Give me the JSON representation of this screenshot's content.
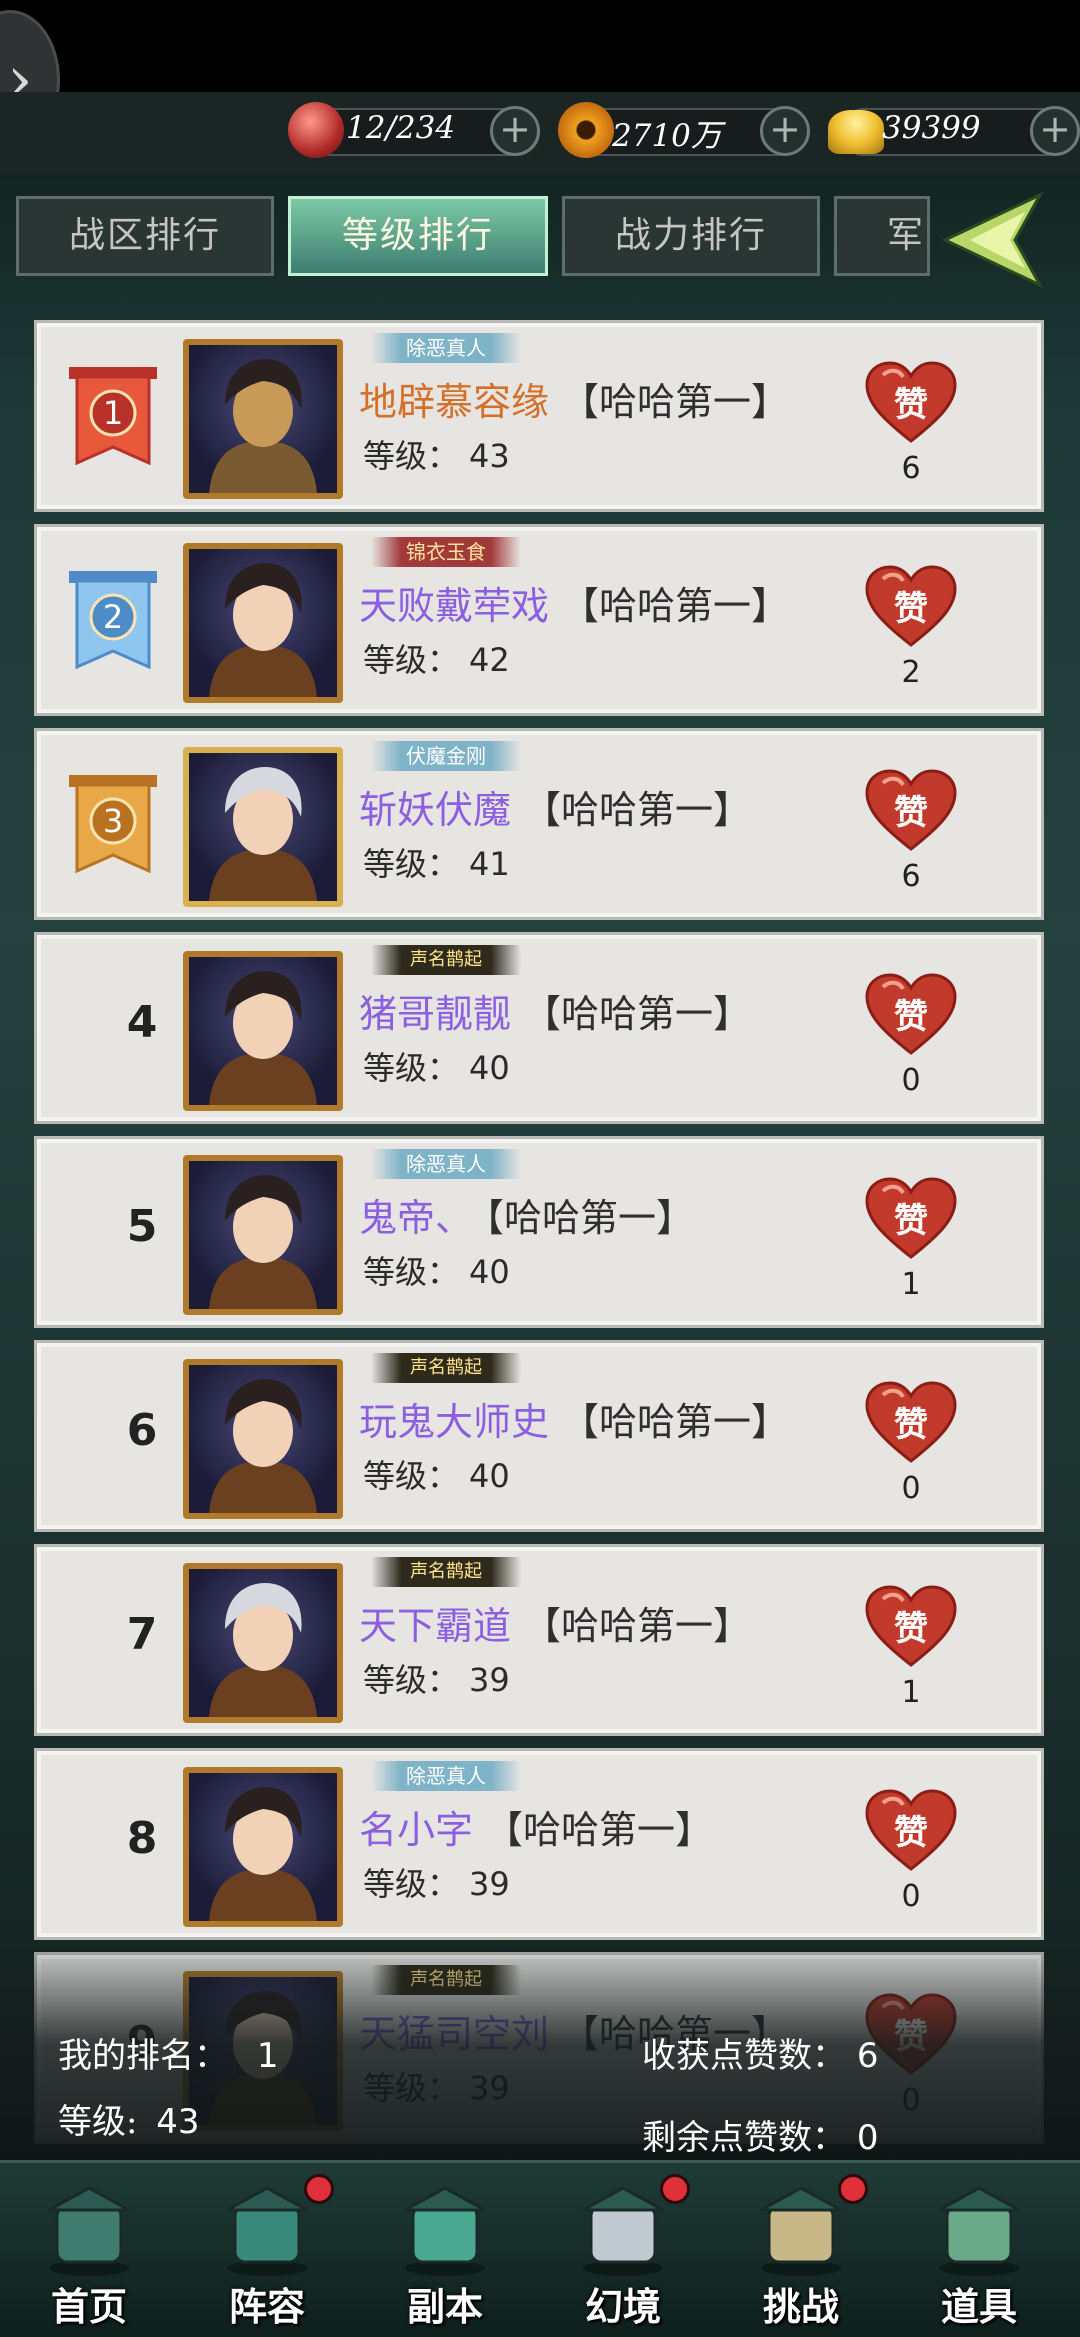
{
  "resources": [
    {
      "icon": "stamina-orb-icon",
      "value": "12/234"
    },
    {
      "icon": "copper-coin-icon",
      "value": "2710万"
    },
    {
      "icon": "gold-ingot-icon",
      "value": "39399"
    }
  ],
  "tabs": [
    {
      "label": "战区排行",
      "active": false
    },
    {
      "label": "等级排行",
      "active": true
    },
    {
      "label": "战力排行",
      "active": false
    },
    {
      "label": "军",
      "active": false
    }
  ],
  "level_prefix": "等级：",
  "like_label": "赞",
  "rankings": [
    {
      "rank": "1",
      "title": "除恶真人",
      "name": "地辟慕容缘",
      "guild": "【哈哈第一】",
      "level": "43",
      "likes": "6"
    },
    {
      "rank": "2",
      "title": "锦衣玉食",
      "name": "天败戴荦戏",
      "guild": "【哈哈第一】",
      "level": "42",
      "likes": "2"
    },
    {
      "rank": "3",
      "title": "伏魔金刚",
      "name": "斩妖伏魔",
      "guild": "【哈哈第一】",
      "level": "41",
      "likes": "6"
    },
    {
      "rank": "4",
      "title": "声名鹊起",
      "name": "猪哥靓靓",
      "guild": "【哈哈第一】",
      "level": "40",
      "likes": "0"
    },
    {
      "rank": "5",
      "title": "除恶真人",
      "name": "鬼帝、",
      "guild": "【哈哈第一】",
      "level": "40",
      "likes": "1"
    },
    {
      "rank": "6",
      "title": "声名鹊起",
      "name": "玩鬼大师史",
      "guild": "【哈哈第一】",
      "level": "40",
      "likes": "0"
    },
    {
      "rank": "7",
      "title": "声名鹊起",
      "name": "天下霸道",
      "guild": "【哈哈第一】",
      "level": "39",
      "likes": "1"
    },
    {
      "rank": "8",
      "title": "除恶真人",
      "name": "名小字",
      "guild": "【哈哈第一】",
      "level": "39",
      "likes": "0"
    },
    {
      "rank": "9",
      "title": "声名鹊起",
      "name": "天猛司空刘",
      "guild": "【哈哈第一】",
      "level": "39",
      "likes": "0"
    }
  ],
  "my_rank": {
    "rank_label": "我的排名：",
    "rank_value": "1",
    "level_label": "等级:",
    "level_value": "43",
    "received_label": "收获点赞数：",
    "received_value": "6",
    "remaining_label": "剩余点赞数：",
    "remaining_value": "0"
  },
  "nav": [
    {
      "label": "首页",
      "icon": "home-pavilion-icon",
      "badge": false
    },
    {
      "label": "阵容",
      "icon": "formation-book-icon",
      "badge": true
    },
    {
      "label": "副本",
      "icon": "dungeon-sword-icon",
      "badge": false
    },
    {
      "label": "幻境",
      "icon": "crossed-swords-icon",
      "badge": true
    },
    {
      "label": "挑战",
      "icon": "challenge-scroll-icon",
      "badge": true
    },
    {
      "label": "道具",
      "icon": "item-bag-icon",
      "badge": false
    }
  ]
}
